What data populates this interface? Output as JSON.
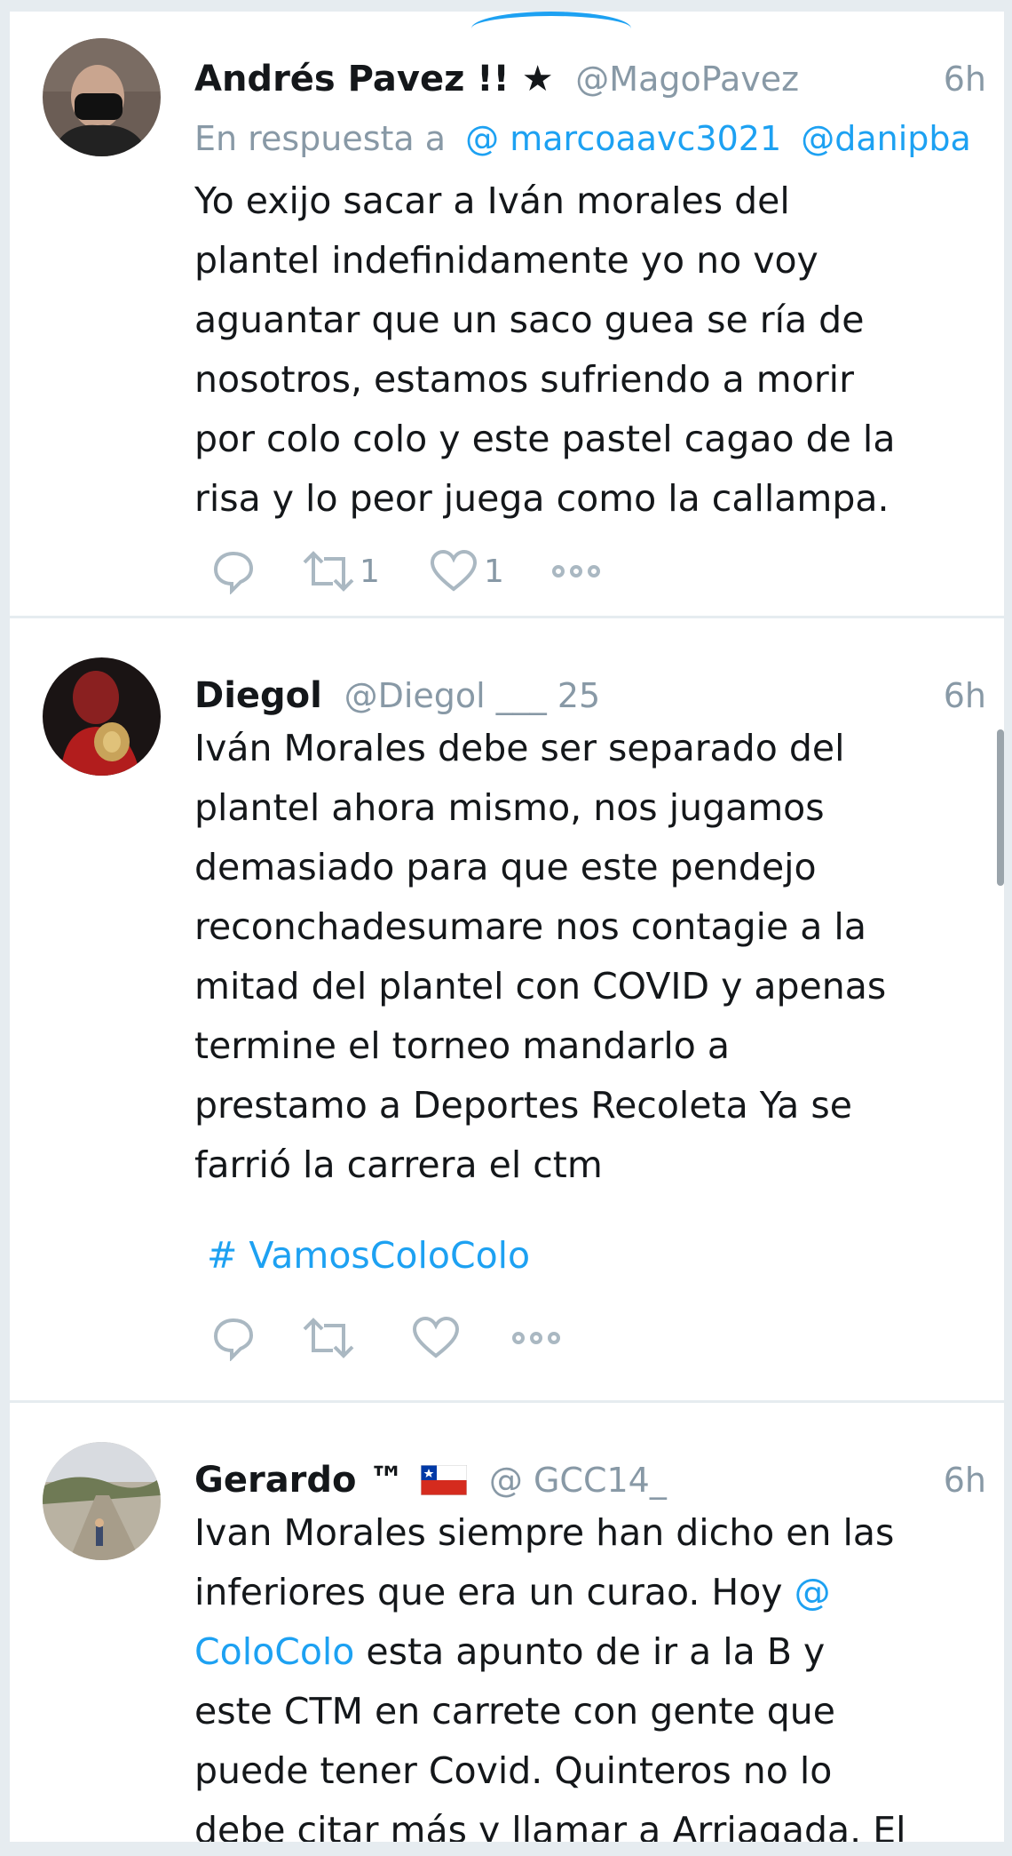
{
  "tweets": [
    {
      "name": "Andrés Pavez !! ★",
      "handle": "@MagoPavez",
      "time": "6h",
      "reply_prefix": "En respuesta a",
      "reply_users": [
        "@ marcoaavc3021",
        "@danipba"
      ],
      "text": "Yo exijo sacar a Iván morales del\nplantel indefinidamente yo no voy\naguantar que un saco guea se ría de\nnosotros, estamos sufriendo a morir\npor colo colo y este pastel cagao de la\nrisa y lo peor juega como la callampa.",
      "retweets": "1",
      "likes": "1"
    },
    {
      "name": "Diegol",
      "handle": "@Diegol ___ 25",
      "time": "6h",
      "text": "Iván Morales debe ser separado del\nplantel ahora mismo, nos jugamos\ndemasiado para que este pendejo\nreconchadesumare nos contagie a la\nmitad del plantel con COVID y apenas\ntermine el torneo mandarlo a\nprestamo a Deportes Recoleta Ya se\nfarrió la carrera el ctm",
      "hashtag": "# VamosColoColo",
      "retweets": "",
      "likes": ""
    },
    {
      "name": "Gerardo ™",
      "handle": "@ GCC14_",
      "time": "6h",
      "text_1": "Ivan Morales siempre han dicho en las\ninferiores que era un curao. Hoy ",
      "mention_1": "@",
      "mention_2": "ColoColo",
      "text_2": " esta apunto de ir a la B y\neste CTM en carrete con gente que\npuede tener Covid. Quinteros no lo\ndebe citar más y llamar a Arriagada. El"
    }
  ],
  "icons": {
    "reply": "reply-icon",
    "retweet": "retweet-icon",
    "like": "heart-icon",
    "more": "more-icon",
    "flag": "chile-flag-icon"
  },
  "colors": {
    "link": "#1da1f2",
    "muted": "#8899a6",
    "text": "#14171a",
    "background": "#e6ecf0"
  }
}
